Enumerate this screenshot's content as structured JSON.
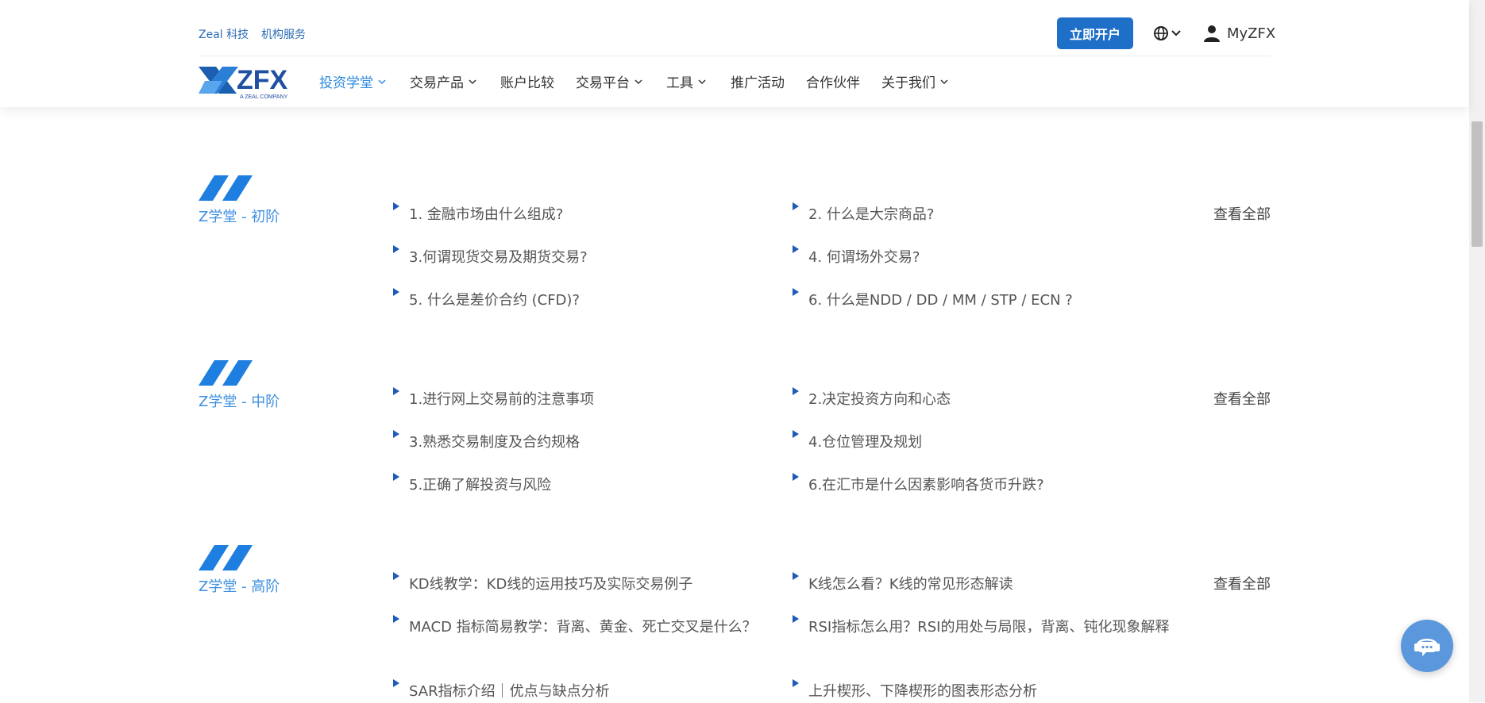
{
  "header": {
    "top_links": [
      "Zeal 科技",
      "机构服务"
    ],
    "open_account": "立即开户",
    "user_label": "MyZFX",
    "logo_text": "ZFX",
    "logo_sub": "A ZEAL COMPANY",
    "nav": [
      {
        "label": "投资学堂",
        "has_dropdown": true,
        "active": true
      },
      {
        "label": "交易产品",
        "has_dropdown": true
      },
      {
        "label": "账户比较",
        "has_dropdown": false
      },
      {
        "label": "交易平台",
        "has_dropdown": true
      },
      {
        "label": "工具",
        "has_dropdown": true
      },
      {
        "label": "推广活动",
        "has_dropdown": false
      },
      {
        "label": "合作伙伴",
        "has_dropdown": false
      },
      {
        "label": "关于我们",
        "has_dropdown": true
      }
    ]
  },
  "sections": [
    {
      "title": "Z学堂 - 初阶",
      "view_all": "查看全部",
      "items": [
        "1. 金融市场由什么组成?",
        "2. 什么是大宗商品?",
        "3.何谓现货交易及期货交易?",
        "4. 何谓场外交易?",
        "5. 什么是差价合约 (CFD)?",
        "6. 什么是NDD / DD / MM / STP / ECN ?"
      ]
    },
    {
      "title": "Z学堂 - 中阶",
      "view_all": "查看全部",
      "items": [
        "1.进行网上交易前的注意事项",
        "2.决定投资方向和心态",
        "3.熟悉交易制度及合约规格",
        "4.仓位管理及规划",
        "5.正确了解投资与风险",
        "6.在汇市是什么因素影响各货币升跌?"
      ]
    },
    {
      "title": "Z学堂 - 高阶",
      "view_all": "查看全部",
      "items": [
        "KD线教学：KD线的运用技巧及实际交易例子",
        "K线怎么看？K线的常见形态解读",
        "MACD 指标简易教学：背离、黄金、死亡交叉是什么？",
        "RSI指标怎么用？RSI的用处与局限，背离、钝化现象解释",
        "SAR指标介绍｜优点与缺点分析",
        "上升楔形、下降楔形的图表形态分析"
      ]
    }
  ],
  "colors": {
    "brand_blue": "#1e6fc8",
    "accent_blue": "#3d8fe0",
    "bullet": "#1e5bb8"
  }
}
